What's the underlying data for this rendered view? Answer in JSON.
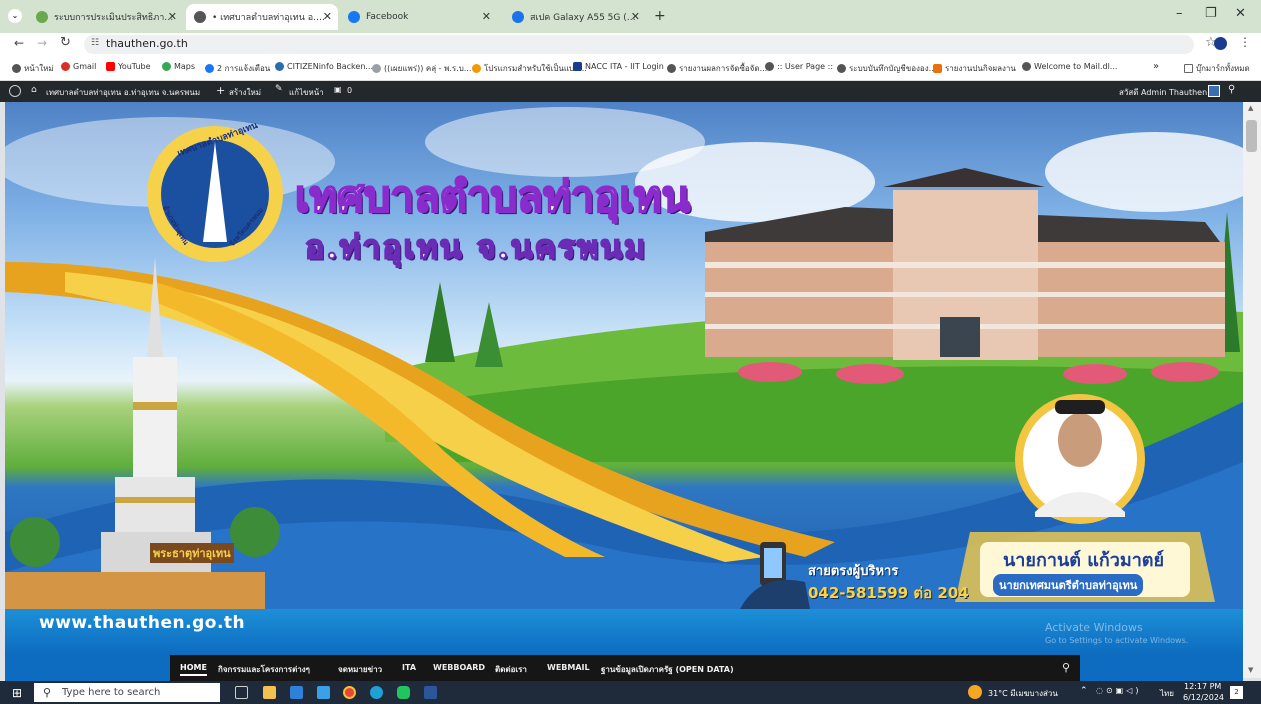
{
  "browser": {
    "tabs": [
      {
        "title": "ระบบการประเมินประสิทธิภาพขององค์",
        "active": false,
        "color": "#6aa84f"
      },
      {
        "title": "• เทศบาลตำบลท่าอุเทน อ.ท่าอุเทน จ.",
        "active": true,
        "color": "#555555"
      },
      {
        "title": "Facebook",
        "active": false,
        "color": "#1877f2"
      },
      {
        "title": "สเปค Galaxy A55 5G (A Awesom",
        "active": false,
        "color": "#1a73e8"
      }
    ],
    "new_tab": "+",
    "url": "thauthen.go.th",
    "bookmarks": [
      {
        "label": "หน้าใหม่",
        "color": "#555"
      },
      {
        "label": "Gmail",
        "color": "#d93025"
      },
      {
        "label": "YouTube",
        "color": "#ff0000"
      },
      {
        "label": "Maps",
        "color": "#34a853"
      },
      {
        "label": "2 การแจ้งเตือน",
        "color": "#1877f2"
      },
      {
        "label": "CITIZENinfo Backen...",
        "color": "#2b6cb0"
      },
      {
        "label": "((เผยแพร่)) คลุ่ - พ.ร.บ...",
        "color": "#9aa0a6"
      },
      {
        "label": "โปรแกรมสำหรับใช้เป็นแบบ...",
        "color": "#f29900"
      },
      {
        "label": "NACC ITA - IIT Login",
        "color": "#1a3c8f"
      },
      {
        "label": "รายงานผลการจัดซื้อจัด...",
        "color": "#555"
      },
      {
        "label": ":: User Page ::",
        "color": "#555"
      },
      {
        "label": "ระบบบันทึกบัญชีขององ...",
        "color": "#555"
      },
      {
        "label": "รายงานปนกิจผลงาน",
        "color": "#e8710a"
      },
      {
        "label": "Welcome to Mail.dl...",
        "color": "#555"
      }
    ],
    "bookmarks_more": "»",
    "all_bookmarks": "บุ๊กมาร์กทั้งหมด"
  },
  "wp_admin": {
    "site_name": "เทศบาลตำบลท่าอุเทน อ.ท่าอุเทน จ.นครพนม",
    "new": "สร้างใหม่",
    "edit": "แก้ไขหน้า",
    "comments": "0",
    "greeting": "สวัสดี Admin Thauthen"
  },
  "banner": {
    "title": "เทศบาลตำบลท่าอุเทน",
    "subtitle": "อ.ท่าอุเทน จ.นครพนม",
    "seal_top": "เทศบาลตำบลท่าอุเทน",
    "seal_left": "อำเภอท่าอุเทน",
    "seal_right": "จังหวัดนครพนม",
    "stupa_sign": "พระธาตุท่าอุเทน",
    "hotline_label": "สายตรงผู้บริหาร",
    "hotline_number": "042-581599 ต่อ 204",
    "mayor_name": "นายกานต์ แก้วมาตย์",
    "mayor_title": "นายกเทศมนตรีตำบลท่าอุเทน",
    "website": "www.thauthen.go.th"
  },
  "watermark": {
    "line1": "Activate Windows",
    "line2": "Go to Settings to activate Windows."
  },
  "nav": {
    "items": [
      "HOME",
      "กิจกรรมและโครงการต่างๆ",
      "จดหมายข่าว",
      "ITA",
      "WEBBOARD",
      "ติดต่อเรา",
      "WEBMAIL",
      "ฐานข้อมูลเปิดภาครัฐ (OPEN DATA)"
    ]
  },
  "taskbar": {
    "search_placeholder": "Type here to search",
    "weather": "31°C มีเมฆบางส่วน",
    "lang": "ไทย",
    "time": "12:17 PM",
    "date": "6/12/2024",
    "notif": "2"
  }
}
